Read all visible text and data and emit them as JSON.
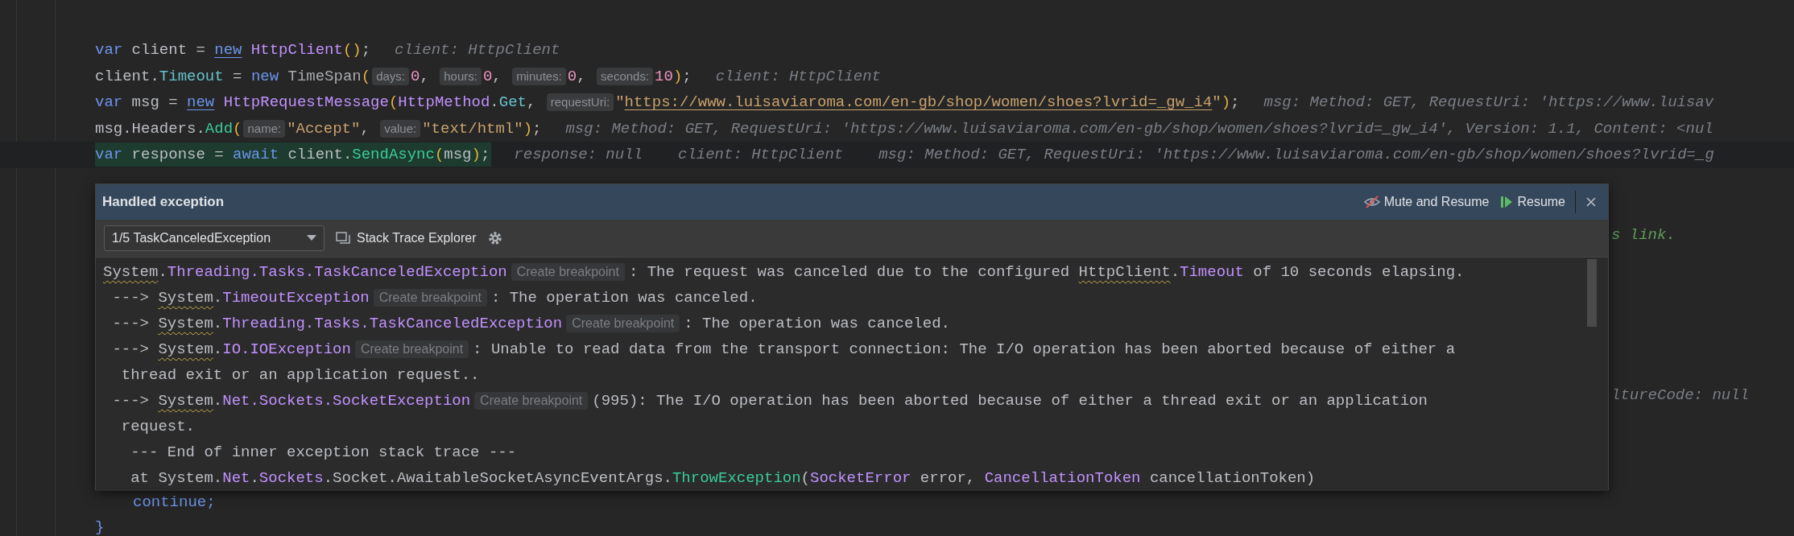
{
  "editor": {
    "lines": [
      {
        "current": false,
        "tokens": [
          {
            "text": "var",
            "kind": "keyword"
          },
          {
            "text": " client = ",
            "kind": "plain"
          },
          {
            "text": "new",
            "kind": "keyword_link"
          },
          {
            "text": " HttpClient",
            "kind": "type"
          },
          {
            "text": "()",
            "kind": "paren"
          },
          {
            "text": ";",
            "kind": "plain"
          }
        ],
        "hints": [
          "client: HttpClient"
        ]
      },
      {
        "current": false,
        "tokens": [
          {
            "text": "client.",
            "kind": "plain"
          },
          {
            "text": "Timeout",
            "kind": "property"
          },
          {
            "text": " = ",
            "kind": "plain"
          },
          {
            "text": "new",
            "kind": "keyword"
          },
          {
            "text": " TimeSpan",
            "kind": "dim"
          },
          {
            "text": "(",
            "kind": "paren"
          },
          {
            "text": "days:",
            "kind": "param"
          },
          {
            "text": "0",
            "kind": "number"
          },
          {
            "text": ", ",
            "kind": "plain"
          },
          {
            "text": "hours:",
            "kind": "param"
          },
          {
            "text": "0",
            "kind": "number"
          },
          {
            "text": ", ",
            "kind": "plain"
          },
          {
            "text": "minutes:",
            "kind": "param"
          },
          {
            "text": "0",
            "kind": "number"
          },
          {
            "text": ", ",
            "kind": "plain"
          },
          {
            "text": "seconds:",
            "kind": "param"
          },
          {
            "text": "10",
            "kind": "number"
          },
          {
            "text": ")",
            "kind": "paren"
          },
          {
            "text": ";",
            "kind": "plain"
          }
        ],
        "hints": [
          "client: HttpClient"
        ]
      },
      {
        "current": false,
        "tokens": [
          {
            "text": "var",
            "kind": "keyword"
          },
          {
            "text": " msg = ",
            "kind": "plain"
          },
          {
            "text": "new",
            "kind": "keyword_link"
          },
          {
            "text": " HttpRequestMessage",
            "kind": "type"
          },
          {
            "text": "(",
            "kind": "paren"
          },
          {
            "text": "HttpMethod",
            "kind": "type"
          },
          {
            "text": ".",
            "kind": "plain"
          },
          {
            "text": "Get",
            "kind": "property"
          },
          {
            "text": ", ",
            "kind": "plain"
          },
          {
            "text": "requestUri:",
            "kind": "param"
          },
          {
            "text": "\"",
            "kind": "string"
          },
          {
            "text": "https://www.luisaviaroma.com/en-gb/shop/women/shoes?lvrid=_gw_i4",
            "kind": "string_link"
          },
          {
            "text": "\"",
            "kind": "string"
          },
          {
            "text": ")",
            "kind": "paren"
          },
          {
            "text": ";",
            "kind": "plain"
          }
        ],
        "hints": [
          "msg: Method: GET, RequestUri: 'https://www.luisav"
        ]
      },
      {
        "current": false,
        "tokens": [
          {
            "text": "msg.Headers.",
            "kind": "plain"
          },
          {
            "text": "Add",
            "kind": "method"
          },
          {
            "text": "(",
            "kind": "paren"
          },
          {
            "text": "name:",
            "kind": "param"
          },
          {
            "text": "\"Accept\"",
            "kind": "string"
          },
          {
            "text": ", ",
            "kind": "plain"
          },
          {
            "text": "value:",
            "kind": "param"
          },
          {
            "text": "\"text/html\"",
            "kind": "string"
          },
          {
            "text": ")",
            "kind": "paren"
          },
          {
            "text": ";",
            "kind": "plain"
          }
        ],
        "hints": [
          "msg: Method: GET, RequestUri: 'https://www.luisaviaroma.com/en-gb/shop/women/shoes?lvrid=_gw_i4', Version: 1.1, Content: <nul"
        ]
      },
      {
        "current": true,
        "tokens": [
          {
            "text": "var",
            "kind": "keyword"
          },
          {
            "text": " response = ",
            "kind": "plain"
          },
          {
            "text": "await",
            "kind": "keyword"
          },
          {
            "text": " client.",
            "kind": "plain"
          },
          {
            "text": "SendAsync",
            "kind": "method"
          },
          {
            "text": "(",
            "kind": "paren"
          },
          {
            "text": "msg",
            "kind": "plain"
          },
          {
            "text": ")",
            "kind": "paren"
          },
          {
            "text": ";",
            "kind": "plain"
          }
        ],
        "hints": [
          "response: null",
          "client: HttpClient",
          "msg: Method: GET, RequestUri: 'https://www.luisaviaroma.com/en-gb/shop/women/shoes?lvrid=_g"
        ]
      }
    ],
    "fragments": [
      {
        "text": "s link.",
        "kind": "comment"
      },
      {
        "text": "ltureCode: null",
        "kind": "hint"
      },
      {
        "text": "continue;",
        "kind": "keyword"
      },
      {
        "text": "}",
        "kind": "keyword"
      }
    ]
  },
  "popup": {
    "title": "Handled exception",
    "actions": [
      {
        "label": "Mute and Resume",
        "kind": "mute"
      },
      {
        "label": "Resume",
        "kind": "resume"
      }
    ],
    "exception_selector": "1/5 TaskCanceledException",
    "stack_trace_button": "Stack Trace Explorer",
    "trace_lines": [
      [
        {
          "text": "System",
          "kind": "squiggle"
        },
        {
          "text": ".",
          "kind": "plain"
        },
        {
          "text": "Threading.Tasks.TaskCanceledException",
          "kind": "type"
        },
        {
          "text": "Create breakpoint",
          "kind": "badge"
        },
        {
          "text": ": The request was canceled due to the configured ",
          "kind": "plain"
        },
        {
          "text": "HttpClient",
          "kind": "squiggle"
        },
        {
          "text": ".",
          "kind": "plain"
        },
        {
          "text": "Timeout",
          "kind": "type"
        },
        {
          "text": " of 10 seconds elapsing.",
          "kind": "plain"
        }
      ],
      [
        {
          "text": " ---> ",
          "kind": "plain"
        },
        {
          "text": "System",
          "kind": "squiggle"
        },
        {
          "text": ".",
          "kind": "plain"
        },
        {
          "text": "TimeoutException",
          "kind": "type"
        },
        {
          "text": "Create breakpoint",
          "kind": "badge"
        },
        {
          "text": ": The operation was canceled.",
          "kind": "plain"
        }
      ],
      [
        {
          "text": " ---> ",
          "kind": "plain"
        },
        {
          "text": "System",
          "kind": "squiggle"
        },
        {
          "text": ".",
          "kind": "plain"
        },
        {
          "text": "Threading.Tasks.TaskCanceledException",
          "kind": "type"
        },
        {
          "text": "Create breakpoint",
          "kind": "badge"
        },
        {
          "text": ": The operation was canceled.",
          "kind": "plain"
        }
      ],
      [
        {
          "text": " ---> ",
          "kind": "plain"
        },
        {
          "text": "System",
          "kind": "squiggle"
        },
        {
          "text": ".",
          "kind": "plain"
        },
        {
          "text": "IO.IOException",
          "kind": "type"
        },
        {
          "text": "Create breakpoint",
          "kind": "badge"
        },
        {
          "text": ": Unable to read data from the transport connection: The I/O operation has been aborted because of either a",
          "kind": "plain"
        }
      ],
      [
        {
          "text": "  thread exit or an application request..",
          "kind": "plain"
        }
      ],
      [
        {
          "text": " ---> ",
          "kind": "plain"
        },
        {
          "text": "System",
          "kind": "squiggle"
        },
        {
          "text": ".",
          "kind": "plain"
        },
        {
          "text": "Net.Sockets.SocketException",
          "kind": "type"
        },
        {
          "text": "Create breakpoint",
          "kind": "badge"
        },
        {
          "text": "(995): The I/O operation has been aborted because of either a thread exit or an application",
          "kind": "plain"
        }
      ],
      [
        {
          "text": "  request.",
          "kind": "plain"
        }
      ],
      [
        {
          "text": "   --- End of inner exception stack trace ---",
          "kind": "plain"
        }
      ],
      [
        {
          "text": "   at System.",
          "kind": "plain"
        },
        {
          "text": "Net",
          "kind": "type"
        },
        {
          "text": ".",
          "kind": "plain"
        },
        {
          "text": "Sockets",
          "kind": "type"
        },
        {
          "text": ".Socket.AwaitableSocketAsyncEventArgs.",
          "kind": "plain"
        },
        {
          "text": "ThrowException",
          "kind": "method"
        },
        {
          "text": "(",
          "kind": "plain"
        },
        {
          "text": "SocketError",
          "kind": "type"
        },
        {
          "text": " error, ",
          "kind": "plain"
        },
        {
          "text": "CancellationToken",
          "kind": "type"
        },
        {
          "text": " cancellationToken)",
          "kind": "plain"
        }
      ]
    ]
  }
}
